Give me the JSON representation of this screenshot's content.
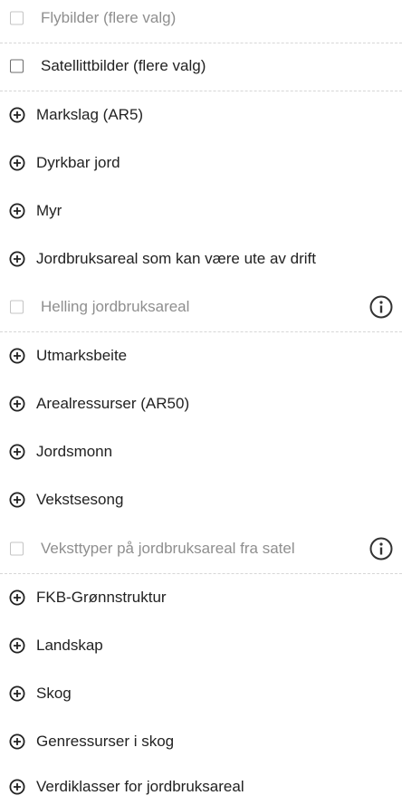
{
  "layers": {
    "flybilder": "Flybilder (flere valg)",
    "satellittbilder": "Satellittbilder (flere valg)",
    "markslag": "Markslag (AR5)",
    "dyrkbar_jord": "Dyrkbar jord",
    "myr": "Myr",
    "jordbruksareal_ute_av_drift": "Jordbruksareal som kan være ute av drift",
    "helling_jordbruksareal": "Helling jordbruksareal",
    "utmarksbeite": "Utmarksbeite",
    "arealressurser": "Arealressurser (AR50)",
    "jordsmonn": "Jordsmonn",
    "vekstsesong": "Vekstsesong",
    "veksttyper": "Veksttyper på jordbruksareal fra satel",
    "fkb_gronnstruktur": "FKB-Grønnstruktur",
    "landskap": "Landskap",
    "skog": "Skog",
    "genressurser_skog": "Genressurser i skog",
    "verdiklasser": "Verdiklasser for jordbruksareal"
  },
  "colors": {
    "text": "#222222",
    "disabled_text": "#8f8f8f",
    "separator": "#d6d6d6"
  },
  "icons": {
    "checkbox": "checkbox-unchecked-icon",
    "expand": "plus-circle-icon",
    "info": "info-icon"
  }
}
